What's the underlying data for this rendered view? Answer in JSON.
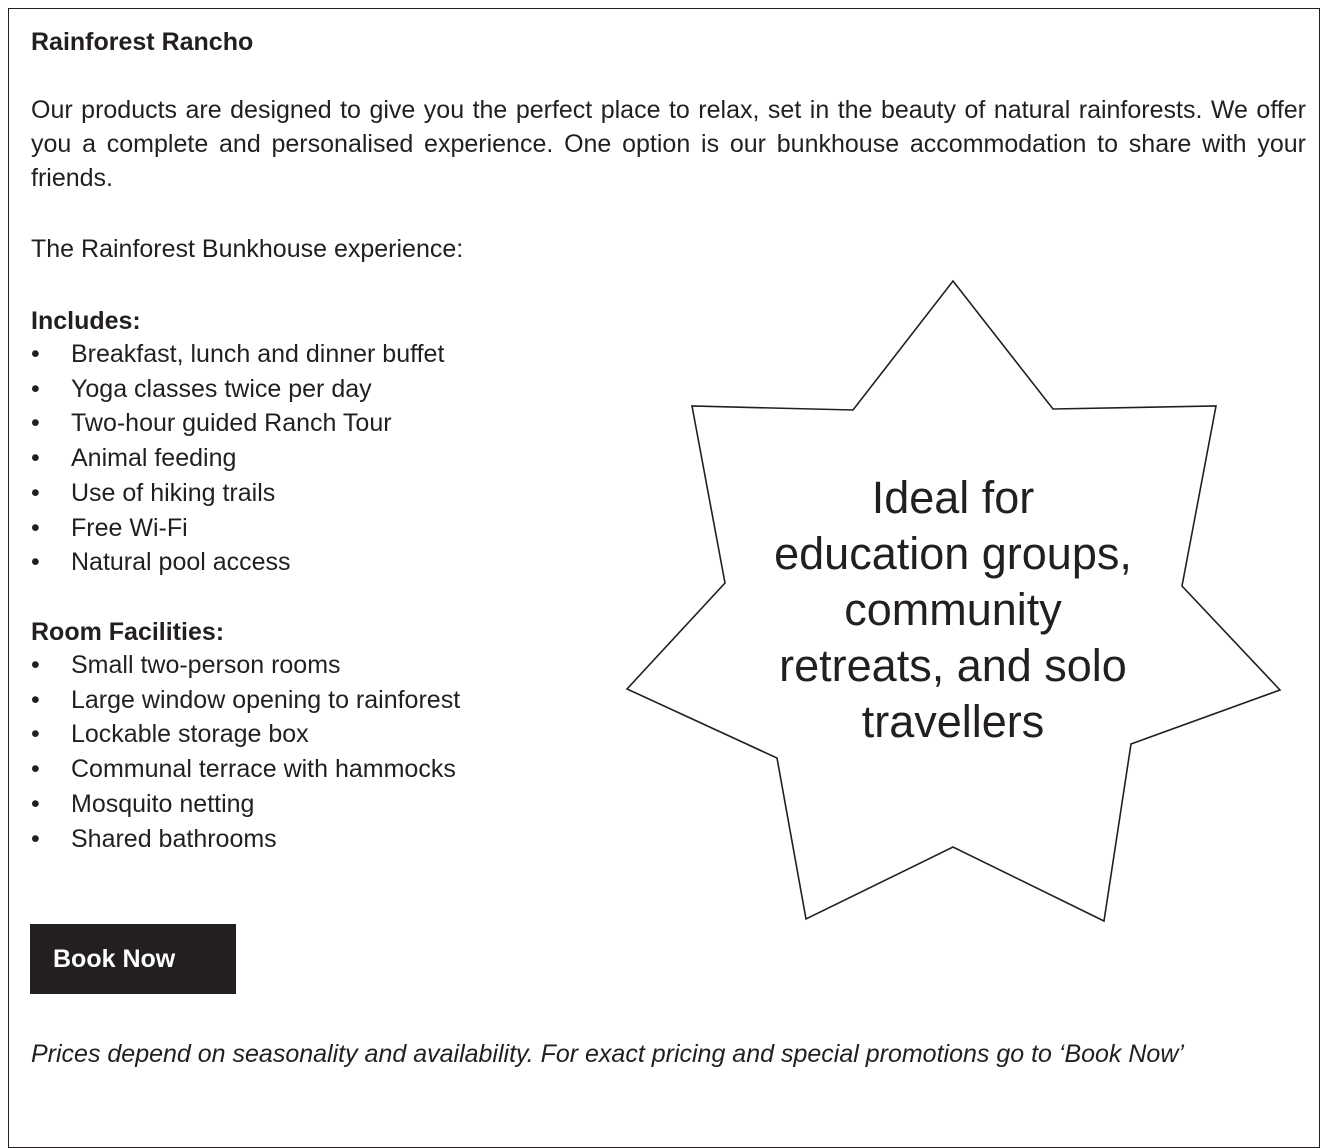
{
  "header": {
    "title": "Rainforest Rancho"
  },
  "intro": "Our products are designed to give you the perfect place to relax, set in the beauty of natural rainforests. We offer you a complete and personalised experience. One option is our bunkhouse accommodation to share with your friends.",
  "subheading": "The Rainforest Bunkhouse experience:",
  "includes": {
    "heading": "Includes:",
    "items": [
      "Breakfast, lunch and dinner buffet",
      "Yoga classes twice per day",
      "Two-hour guided Ranch Tour",
      "Animal feeding",
      "Use of hiking trails",
      "Free Wi-Fi",
      "Natural pool access"
    ]
  },
  "facilities": {
    "heading": "Room Facilities:",
    "items": [
      "Small two-person rooms",
      "Large window opening to rainforest",
      "Lockable storage box",
      "Communal terrace with hammocks",
      "Mosquito netting",
      "Shared bathrooms"
    ]
  },
  "star": {
    "lines": [
      "Ideal for",
      "education groups,",
      "community",
      "retreats, and solo",
      "travellers"
    ]
  },
  "book_button": {
    "label": "Book Now"
  },
  "footnote": "Prices depend on seasonality and availability. For exact pricing and special promotions go to ‘Book Now’"
}
